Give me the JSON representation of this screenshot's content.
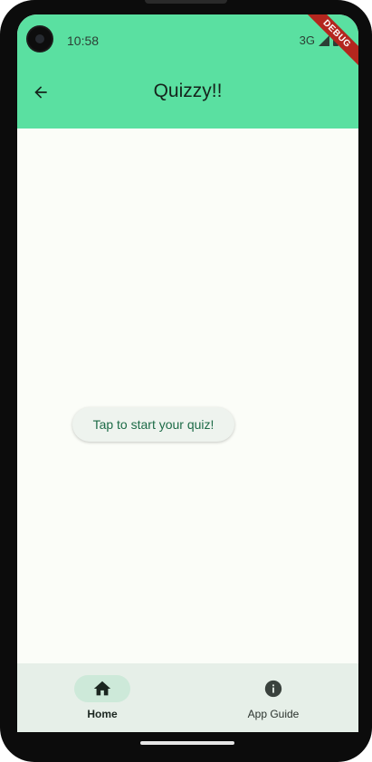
{
  "status_bar": {
    "time": "10:58",
    "network": "3G"
  },
  "debug_banner": "DEBUG",
  "app_bar": {
    "title": "Quizzy!!",
    "back_icon": "arrow-back-icon"
  },
  "main": {
    "start_button_label": "Tap to start your quiz!"
  },
  "bottom_nav": {
    "items": [
      {
        "label": "Home",
        "icon": "home-icon",
        "selected": true
      },
      {
        "label": "App Guide",
        "icon": "info-icon",
        "selected": false
      }
    ]
  },
  "colors": {
    "app_bar": "#5ae0a1",
    "background": "#fbfdf8",
    "button_text": "#1d6b47",
    "nav_background": "#e6efe8",
    "nav_indicator": "#cde9d9",
    "debug_ribbon": "#b3261e"
  }
}
